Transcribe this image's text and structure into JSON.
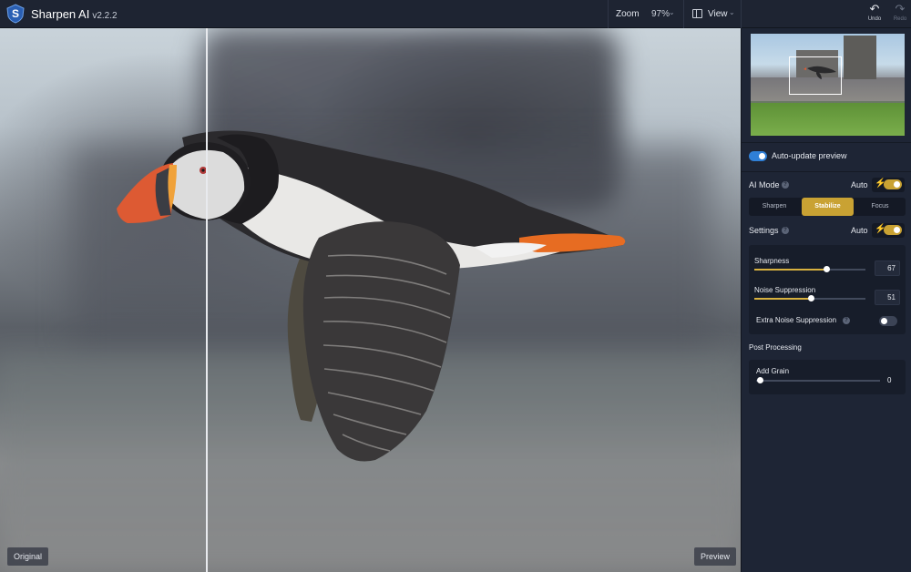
{
  "app": {
    "name": "Sharpen AI",
    "version": "v2.2.2"
  },
  "toolbar": {
    "zoom_label": "Zoom",
    "zoom_value": "97%",
    "view_label": "View",
    "undo_label": "Undo",
    "redo_label": "Redo"
  },
  "canvas": {
    "original_label": "Original",
    "preview_label": "Preview"
  },
  "panel": {
    "auto_update_label": "Auto-update preview",
    "auto_update_on": true,
    "ai_mode_label": "AI Mode",
    "auto_label": "Auto",
    "modes": [
      "Sharpen",
      "Stabilize",
      "Focus"
    ],
    "active_mode": "Stabilize",
    "settings_label": "Settings",
    "sharpness_label": "Sharpness",
    "sharpness_value": "67",
    "noise_label": "Noise Suppression",
    "noise_value": "51",
    "extra_noise_label": "Extra Noise Suppression",
    "extra_noise_on": false,
    "post_processing_label": "Post Processing",
    "add_grain_label": "Add Grain",
    "add_grain_value": "0"
  },
  "colors": {
    "accent_gold": "#c9a233",
    "accent_blue": "#2f7fd6",
    "panel_bg": "#1e2535"
  }
}
